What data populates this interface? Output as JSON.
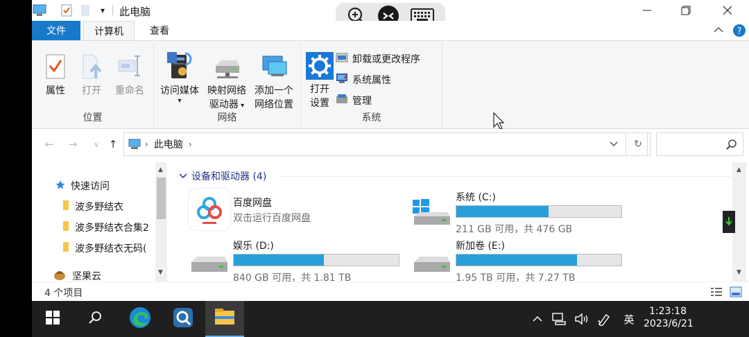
{
  "window": {
    "title": "此电脑"
  },
  "tabs": {
    "file": "文件",
    "computer": "计算机",
    "view": "查看"
  },
  "ribbon": {
    "location": {
      "label": "位置",
      "properties": "属性",
      "open": "打开",
      "rename": "重命名"
    },
    "network": {
      "label": "网络",
      "access_media": "访问媒体",
      "map_drive_1": "映射网络",
      "map_drive_2": "驱动器",
      "add_location_1": "添加一个",
      "add_location_2": "网络位置"
    },
    "system": {
      "label": "系统",
      "open_settings_1": "打开",
      "open_settings_2": "设置",
      "uninstall": "卸载或更改程序",
      "properties": "系统属性",
      "manage": "管理"
    }
  },
  "address": {
    "path": "此电脑"
  },
  "navpane": {
    "quick_access": "快速访问",
    "items": [
      "波多野结衣",
      "波多野结衣合集2",
      "波多野结衣无码("
    ],
    "jianguoyun": "坚果云"
  },
  "content": {
    "group_header": "设备和驱动器 (4)",
    "drives": [
      {
        "name": "百度网盘",
        "subtitle": "双击运行百度网盘"
      },
      {
        "name": "系统 (C:)",
        "info": "211 GB 可用，共 476 GB",
        "used_fraction": 0.557
      },
      {
        "name": "娱乐 (D:)",
        "info": "840 GB 可用，共 1.81 TB",
        "used_fraction": 0.547
      },
      {
        "name": "新加卷 (E:)",
        "info": "1.95 TB 可用，共 7.27 TB",
        "used_fraction": 0.732
      }
    ]
  },
  "status": {
    "count": "4 个项目"
  },
  "taskbar": {
    "ime": "英",
    "time": "1:23:18",
    "date": "2023/6/21"
  },
  "colors": {
    "accent": "#1979ca",
    "drive_bar": "#26a0da",
    "taskbar": "#1f1f1f"
  }
}
